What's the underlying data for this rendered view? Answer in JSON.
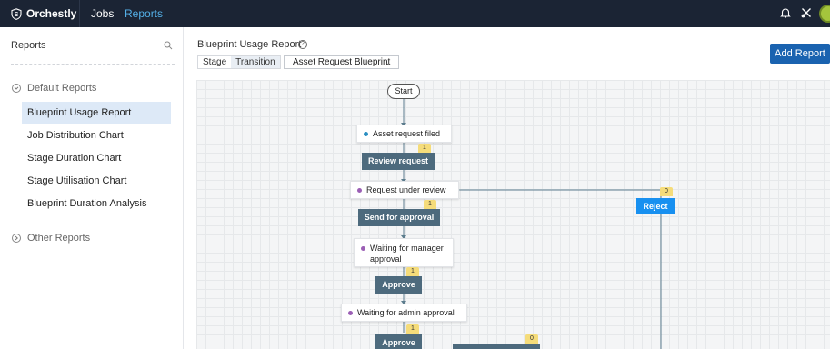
{
  "topbar": {
    "brand": "Orchestly",
    "nav": {
      "jobs": "Jobs",
      "reports": "Reports"
    }
  },
  "sidebar": {
    "title": "Reports",
    "default_group": "Default Reports",
    "items": [
      "Blueprint Usage Report",
      "Job Distribution Chart",
      "Stage Duration Chart",
      "Stage Utilisation Chart",
      "Blueprint Duration Analysis"
    ],
    "active_item": "Blueprint Usage Report",
    "other_group": "Other Reports"
  },
  "main": {
    "title": "Blueprint Usage Report",
    "toggle": [
      "Stage",
      "Transition"
    ],
    "toggle_selected": "Transition",
    "blueprint_select": "Asset Request Blueprint",
    "add_button": "Add Report"
  },
  "flow": {
    "start": "Start",
    "states": [
      {
        "label": "Asset request filed",
        "dot": "#2b8fc2"
      },
      {
        "label": "Request under review",
        "dot": "#9b5fb5"
      },
      {
        "label_line1": "Waiting for manager",
        "label_line2": "approval",
        "dot": "#9b5fb5"
      },
      {
        "label": "Waiting for admin approval",
        "dot": "#9b5fb5"
      }
    ],
    "transitions": [
      {
        "label": "Review request",
        "count": "1"
      },
      {
        "label": "Send for approval",
        "count": "1"
      },
      {
        "label": "Approve",
        "count": "1"
      },
      {
        "label": "Approve",
        "count": "1"
      }
    ],
    "reject": {
      "label": "Reject",
      "count": "0"
    },
    "extra_count": "0"
  },
  "colors": {
    "topbar_bg": "#1b2434",
    "nav_active": "#54b0e8",
    "primary_button": "#1a63b0",
    "transition_bg": "#4d6a7d",
    "reject_bg": "#1890f0",
    "badge_bg": "#f5dc7a",
    "sidebar_active_bg": "#dde9f7"
  },
  "icons": [
    "shield-logo-icon",
    "bell-icon",
    "tools-icon",
    "search-icon",
    "help-icon",
    "collapse-icon",
    "expand-icon",
    "chevron-down-icon"
  ]
}
